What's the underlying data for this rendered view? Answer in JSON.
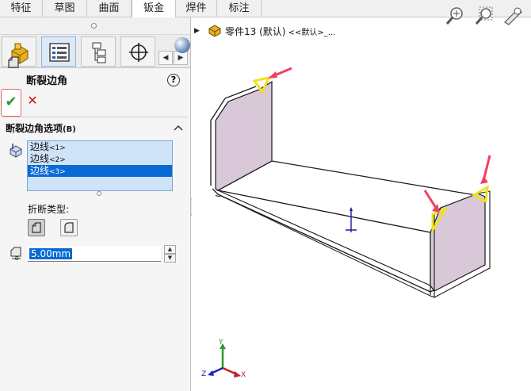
{
  "tabs": [
    {
      "label": "特征"
    },
    {
      "label": "草图"
    },
    {
      "label": "曲面"
    },
    {
      "label": "钣金",
      "active": true
    },
    {
      "label": "焊件"
    },
    {
      "label": "标注"
    }
  ],
  "feature": {
    "title": "断裂边角",
    "help": "?",
    "ok": "✔",
    "cancel": "✕"
  },
  "options_group": {
    "title": "断裂边角选项",
    "shortcut": "(B)",
    "collapse_icon": "chevron-up-icon",
    "edges": [
      {
        "label": "边线",
        "index": "<1>",
        "selected": false
      },
      {
        "label": "边线",
        "index": "<2>",
        "selected": false
      },
      {
        "label": "边线",
        "index": "<3>",
        "selected": true
      }
    ],
    "break_type_label": "折断类型:",
    "break_types": [
      "chamfer-icon",
      "fillet-icon"
    ],
    "distance_value": "5.00mm"
  },
  "viewport": {
    "part_name": "零件13 (默认)",
    "config_suffix": "<<默认>_...",
    "triad": {
      "x": "X",
      "y": "Y",
      "z": "Z"
    }
  },
  "colors": {
    "accent": "#0a6ad4",
    "face": "#d8c8d8",
    "highlight": "#f0e020",
    "arrow": "#f04060"
  }
}
